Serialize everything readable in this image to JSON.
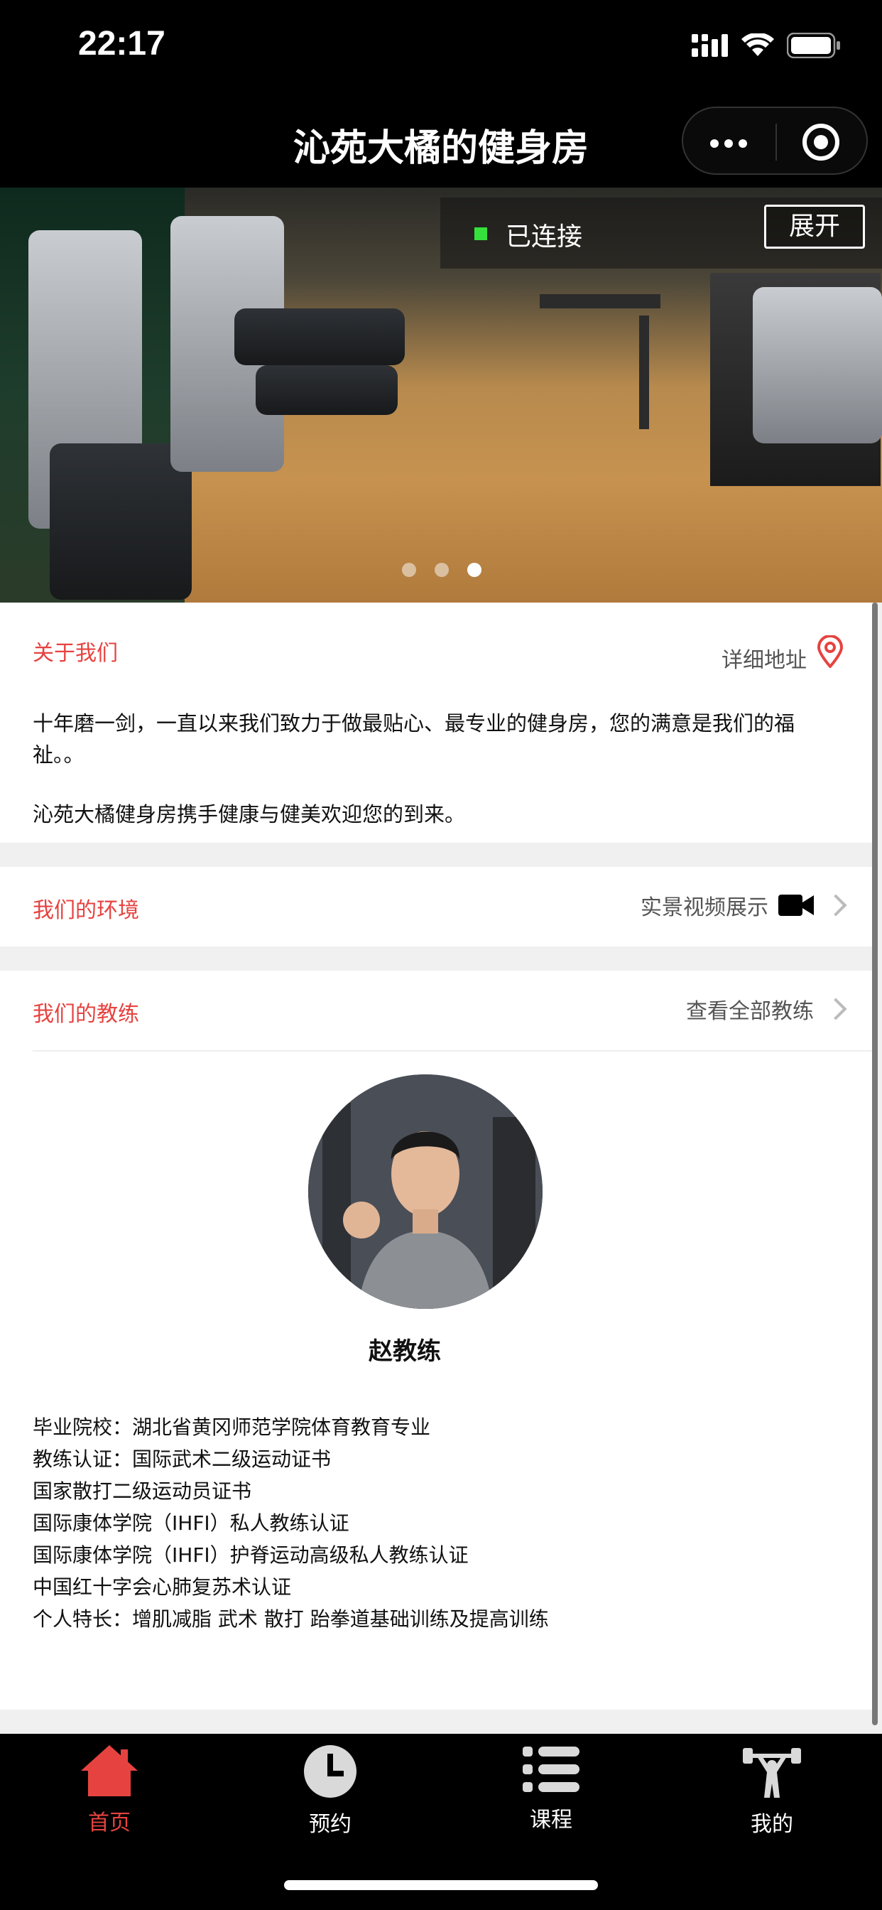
{
  "status_bar": {
    "time": "22:17"
  },
  "nav": {
    "title": "沁苑大橘的健身房"
  },
  "banner": {
    "connection_text": "已连接",
    "expand_label": "展开",
    "slide_count": 3,
    "active_slide": 3
  },
  "about": {
    "title": "关于我们",
    "address_link": "详细地址",
    "paragraph1": "十年磨一剑，一直以来我们致力于做最贴心、最专业的健身房，您的满意是我们的福祉。。",
    "paragraph2": "沁苑大橘健身房携手健康与健美欢迎您的到来。"
  },
  "environment": {
    "title": "我们的环境",
    "video_link": "实景视频展示"
  },
  "coaches": {
    "title": "我们的教练",
    "view_all": "查看全部教练",
    "coach": {
      "name": "赵教练",
      "lines": [
        "毕业院校：湖北省黄冈师范学院体育教育专业",
        "教练认证：国际武术二级运动证书",
        "国家散打二级运动员证书",
        "国际康体学院（IHFI）私人教练认证",
        "国际康体学院（IHFI）护脊运动高级私人教练认证",
        "中国红十字会心肺复苏术认证",
        "个人特长：增肌减脂 武术 散打 跆拳道基础训练及提高训练"
      ]
    }
  },
  "tabbar": {
    "items": [
      {
        "label": "首页",
        "icon": "home-icon",
        "active": true
      },
      {
        "label": "预约",
        "icon": "clock-icon",
        "active": false
      },
      {
        "label": "课程",
        "icon": "list-icon",
        "active": false
      },
      {
        "label": "我的",
        "icon": "weightlifter-icon",
        "active": false
      }
    ]
  },
  "colors": {
    "accent": "#e64340",
    "connected": "#36e03c",
    "bar_bg": "#000000"
  }
}
